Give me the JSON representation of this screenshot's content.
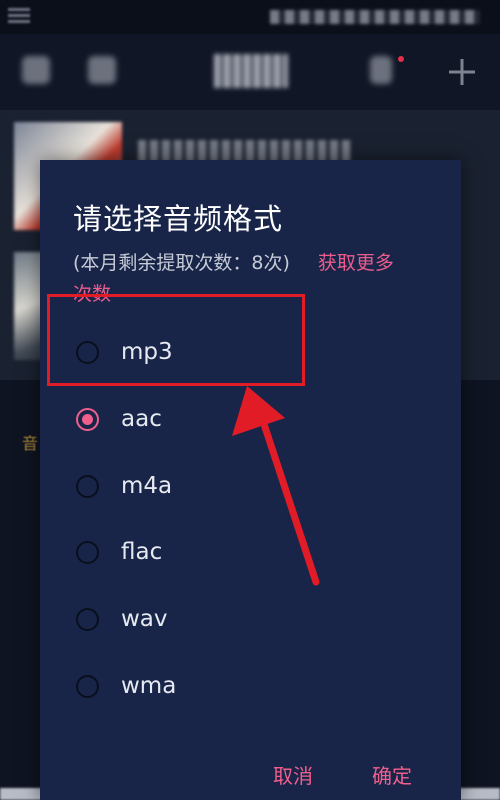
{
  "dialog": {
    "title": "请选择音频格式",
    "quota_text": "(本月剩余提取次数：8次)",
    "get_more_line1": "获取更多",
    "get_more_line2": "次数",
    "options": [
      {
        "label": "mp3",
        "checked": false
      },
      {
        "label": "aac",
        "checked": true
      },
      {
        "label": "m4a",
        "checked": false
      },
      {
        "label": "flac",
        "checked": false
      },
      {
        "label": "wav",
        "checked": false
      },
      {
        "label": "wma",
        "checked": false
      }
    ],
    "cancel_label": "取消",
    "confirm_label": "确定"
  },
  "background": {
    "peek_text": "音"
  },
  "colors": {
    "dialog_bg": "#182549",
    "accent_pink": "#ef5f8c",
    "annotation_red": "#e21c27"
  },
  "icons": [
    "add-icon",
    "radio-button-icon",
    "red-arrow-annotation"
  ]
}
